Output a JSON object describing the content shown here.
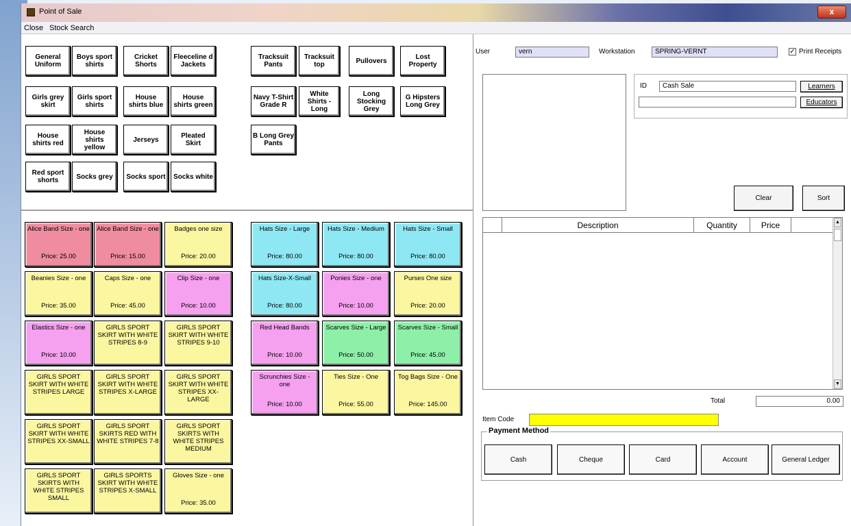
{
  "window": {
    "title": "Point of Sale",
    "close_glyph": "x"
  },
  "menu": {
    "items": [
      "Close",
      "Stock Search"
    ]
  },
  "categories": [
    "General Uniform",
    "Boys sport shirts",
    "Cricket Shorts",
    "Fleeceline d Jackets",
    "Tracksuit Pants",
    "Tracksuit top",
    "Pullovers",
    "Lost Property",
    "Girls grey skirt",
    "Girls sport shirts",
    "House shirts blue",
    "House shirts green",
    "Navy T-Shirt Grade R",
    "White Shirts - Long",
    "Long Stocking Grey",
    "G Hipsters Long Grey",
    "House shirts red",
    "House shirts yellow",
    "Jerseys",
    "Pleated Skirt",
    "B Long Grey Pants",
    "Red sport shorts",
    "Socks grey",
    "Socks sport",
    "Socks white"
  ],
  "products": [
    {
      "name": "Alice Band Size - one",
      "price": "Price: 25.00",
      "color": "#f08ca0"
    },
    {
      "name": "Alice Band Size - one",
      "price": "Price: 15.00",
      "color": "#f08ca0"
    },
    {
      "name": "Badges one size",
      "price": "Price: 20.00",
      "color": "#fbf6a0"
    },
    {
      "name": "Hats Size - Large",
      "price": "Price: 80.00",
      "color": "#8ee8f4"
    },
    {
      "name": "Hats Size - Medium",
      "price": "Price: 80.00",
      "color": "#8ee8f4"
    },
    {
      "name": "Hats Size - Small",
      "price": "Price: 80.00",
      "color": "#8ee8f4"
    },
    {
      "name": "Beanies Size - one",
      "price": "Price: 35.00",
      "color": "#fbf6a0"
    },
    {
      "name": "Caps Size - one",
      "price": "Price: 45.00",
      "color": "#fbf6a0"
    },
    {
      "name": "Clip Size - one",
      "price": "Price: 10.00",
      "color": "#f6a0f0"
    },
    {
      "name": "Hats Size-X-Small",
      "price": "Price: 80.00",
      "color": "#8ee8f4"
    },
    {
      "name": "Ponies Size - one",
      "price": "Price: 10.00",
      "color": "#f6a0f0"
    },
    {
      "name": "Purses One size",
      "price": "Price: 20.00",
      "color": "#fbf6a0"
    },
    {
      "name": "Elastics Size - one",
      "price": "Price: 10.00",
      "color": "#f6a0f0"
    },
    {
      "name": "GIRLS SPORT SKIRT WITH WHITE STRIPES 8-9",
      "price": "",
      "color": "#fbf6a0"
    },
    {
      "name": "GIRLS SPORT SKIRT WITH WHITE STRIPES 9-10",
      "price": "",
      "color": "#fbf6a0"
    },
    {
      "name": "Red Head Bands",
      "price": "Price: 10.00",
      "color": "#f6a0f0"
    },
    {
      "name": "Scarves Size - Large",
      "price": "Price: 50.00",
      "color": "#8ef0a8"
    },
    {
      "name": "Scarves Size - Small",
      "price": "Price: 45.00",
      "color": "#8ef0a8"
    },
    {
      "name": "GIRLS SPORT SKIRT WITH WHITE STRIPES LARGE",
      "price": "",
      "color": "#fbf6a0"
    },
    {
      "name": "GIRLS SPORT SKIRT WITH WHITE STRIPES X-LARGE",
      "price": "",
      "color": "#fbf6a0"
    },
    {
      "name": "GIRLS SPORT SKIRT WITH WHITE STRIPES XX-LARGE",
      "price": "",
      "color": "#fbf6a0"
    },
    {
      "name": "Scrunchies Size - one",
      "price": "Price: 10.00",
      "color": "#f6a0f0"
    },
    {
      "name": "Ties Size - One",
      "price": "Price: 55.00",
      "color": "#fbf6a0"
    },
    {
      "name": "Tog Bags Size - One",
      "price": "Price: 145.00",
      "color": "#fbf6a0"
    },
    {
      "name": "GIRLS SPORT SKIRT WITH WHITE STRIPES XX-SMALL",
      "price": "",
      "color": "#fbf6a0"
    },
    {
      "name": "GIRLS SPORT SKIRTS RED WITH WHITE STRIPES 7-8",
      "price": "",
      "color": "#fbf6a0"
    },
    {
      "name": "GIRLS SPORT SKIRTS WITH WHITE STRIPES MEDIUM",
      "price": "",
      "color": "#fbf6a0"
    },
    {
      "name": "GIRLS SPORT SKIRTS WITH WHITE STRIPES SMALL",
      "price": "",
      "color": "#fbf6a0"
    },
    {
      "name": "GIRLS SPORTS SKIRT WITH WHITE STRIPES X-SMALL",
      "price": "",
      "color": "#fbf6a0"
    },
    {
      "name": "Gloves Size - one",
      "price": "Price: 35.00",
      "color": "#fbf6a0"
    }
  ],
  "header": {
    "user_label": "User",
    "user_value": "vern",
    "workstation_label": "Workstation",
    "workstation_value": "SPRING-VERNT",
    "print_receipts_label": "Print Receipts",
    "print_receipts_checked": true
  },
  "customer": {
    "id_label": "ID",
    "id_value": "Cash Sale",
    "second_value": "",
    "learners_button": "Learners",
    "educators_button": "Educators"
  },
  "actions": {
    "clear_button": "Clear",
    "sort_button": "Sort"
  },
  "grid": {
    "columns": [
      "Description",
      "Quantity",
      "Price"
    ]
  },
  "totals": {
    "total_label": "Total",
    "total_value": "0.00"
  },
  "item_code": {
    "label": "Item Code",
    "value": ""
  },
  "payment": {
    "legend": "Payment Method",
    "buttons": [
      "Cash",
      "Cheque",
      "Card",
      "Account",
      "General Ledger"
    ]
  }
}
